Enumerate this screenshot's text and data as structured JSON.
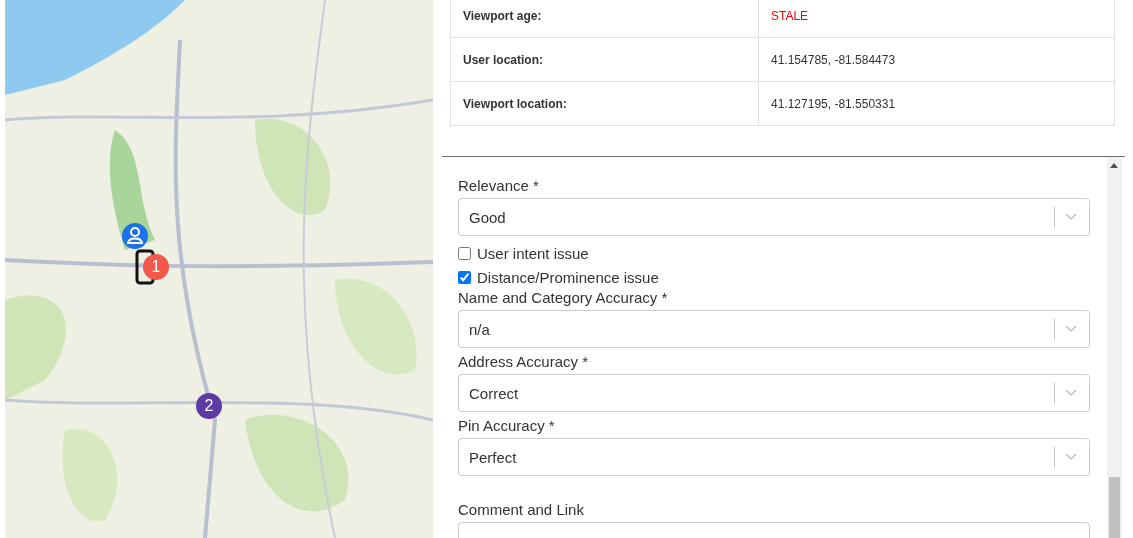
{
  "map": {
    "kind": "picture",
    "markers": [
      {
        "kind": "person",
        "color": "#1a73e8"
      },
      {
        "kind": "phone",
        "color": "#111111"
      },
      {
        "kind": "pin",
        "label": "1",
        "color": "#f2584b"
      },
      {
        "kind": "pin",
        "label": "2",
        "color": "#5e3aa5"
      }
    ]
  },
  "info_table": {
    "rows": [
      {
        "label": "Viewport age:",
        "value": "STALE",
        "alert": true
      },
      {
        "label": "User location:",
        "value": "41.154785, -81.584473",
        "alert": false
      },
      {
        "label": "Viewport location:",
        "value": "41.127195, -81.550331",
        "alert": false
      }
    ]
  },
  "form": {
    "fields": [
      {
        "kind": "select",
        "label": "Relevance *",
        "value": "Good"
      },
      {
        "kind": "checkbox",
        "label": "User intent issue",
        "checked": false
      },
      {
        "kind": "checkbox",
        "label": "Distance/Prominence issue",
        "checked": true
      },
      {
        "kind": "select",
        "label": "Name and Category Accuracy *",
        "value": "n/a"
      },
      {
        "kind": "select",
        "label": "Address Accuracy *",
        "value": "Correct"
      },
      {
        "kind": "select",
        "label": "Pin Accuracy *",
        "value": "Perfect"
      },
      {
        "kind": "textarea",
        "label": "Comment and Link"
      }
    ]
  }
}
